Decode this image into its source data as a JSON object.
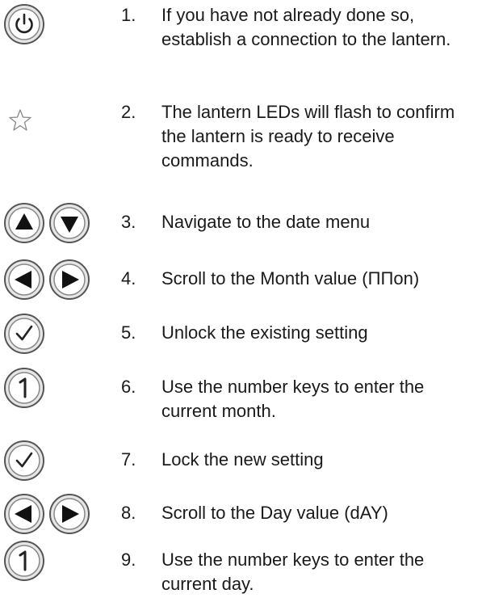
{
  "steps": [
    {
      "number": "1.",
      "text": "If you have not already done so, establish a connection to the lantern.",
      "icons": [
        "power-button-icon"
      ]
    },
    {
      "number": "2.",
      "text": "The lantern LEDs will flash to confirm the lantern is ready to receive commands.",
      "icons": [
        "star-icon"
      ]
    },
    {
      "number": "3.",
      "text": "Navigate to the date menu",
      "icons": [
        "up-arrow-button-icon",
        "down-arrow-button-icon"
      ]
    },
    {
      "number": "4.",
      "text": "Scroll to the Month value (ΠΠon)",
      "icons": [
        "left-arrow-button-icon",
        "right-arrow-button-icon"
      ]
    },
    {
      "number": "5.",
      "text": "Unlock the existing setting",
      "icons": [
        "check-button-icon"
      ]
    },
    {
      "number": "6.",
      "text": "Use the number keys to enter the current month.",
      "icons": [
        "number-one-button-icon"
      ]
    },
    {
      "number": "7.",
      "text": "Lock the new setting",
      "icons": [
        "check-button-icon"
      ]
    },
    {
      "number": "8.",
      "text": "Scroll to the Day value (dAY)",
      "icons": [
        "left-arrow-button-icon",
        "right-arrow-button-icon"
      ]
    },
    {
      "number": "9.",
      "text": "Use the number keys to enter the current day.",
      "icons": [
        "number-one-button-icon"
      ]
    }
  ]
}
